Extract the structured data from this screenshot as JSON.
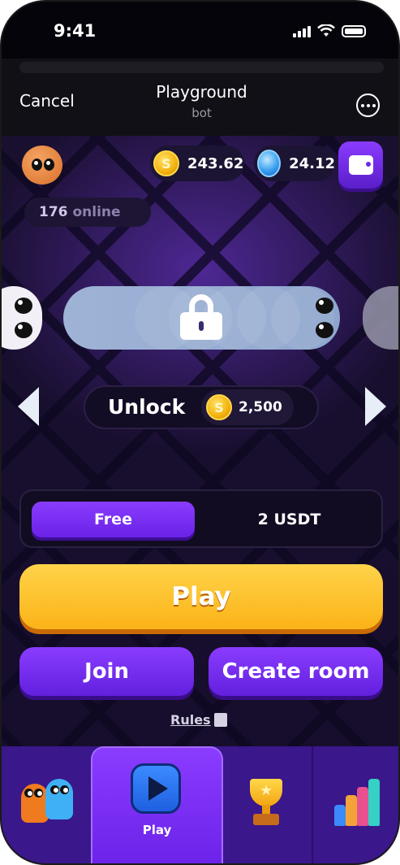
{
  "status": {
    "time": "9:41"
  },
  "header": {
    "cancel_label": "Cancel",
    "title": "Playground",
    "subtitle": "bot",
    "more_icon": "more-options-icon"
  },
  "balances": {
    "coins": "243.62",
    "gems": "24.12",
    "wallet_icon": "wallet-icon"
  },
  "online": {
    "count": "176",
    "label": "online"
  },
  "skin": {
    "locked": true,
    "unlock_label": "Unlock",
    "unlock_price": "2,500"
  },
  "modes": {
    "items": [
      "Free",
      "2 USDT"
    ],
    "selected": "Free"
  },
  "actions": {
    "play_label": "Play",
    "join_label": "Join",
    "create_room_label": "Create room",
    "rules_label": "Rules"
  },
  "tabbar": {
    "active": "Play",
    "tabs": [
      {
        "icon": "snakes-icon"
      },
      {
        "icon": "play-icon",
        "label": "Play"
      },
      {
        "icon": "trophy-icon"
      },
      {
        "icon": "stats-icon"
      }
    ]
  },
  "colors": {
    "accent_purple": "#7b2ff7",
    "play_yellow": "#fbb317",
    "background": "#17102b"
  }
}
